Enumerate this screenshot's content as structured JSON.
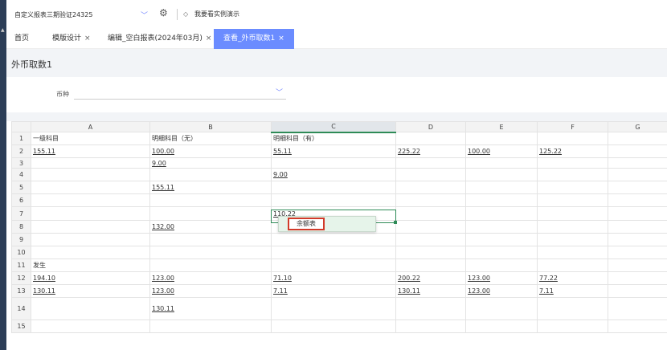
{
  "topbar": {
    "report_name": "自定义报表三期验证24325",
    "demo_label": "我要看实例演示"
  },
  "tabs": [
    {
      "label": "首页",
      "closable": false
    },
    {
      "label": "模版设计",
      "closable": true
    },
    {
      "label": "编辑_空白报表(2024年03月)",
      "closable": true
    },
    {
      "label": "查看_外币取数1",
      "closable": true,
      "active": true
    }
  ],
  "page": {
    "title": "外币取数1",
    "filter_label": "币种",
    "filter_value": ""
  },
  "sheet": {
    "columns": [
      "A",
      "B",
      "C",
      "D",
      "E",
      "F",
      "G"
    ],
    "selected_column": "C",
    "rows": [
      {
        "n": "1",
        "cells": [
          "一级科目",
          "明细科目（无）",
          "明细科目（有）",
          "",
          "",
          "",
          ""
        ]
      },
      {
        "n": "2",
        "cells": [
          "155.11",
          "100.00",
          "55.11",
          "225.22",
          "100.00",
          "125.22",
          ""
        ]
      },
      {
        "n": "3",
        "cells": [
          "",
          "9.00",
          "",
          "",
          "",
          "",
          ""
        ]
      },
      {
        "n": "4",
        "cells": [
          "",
          "",
          "9.00",
          "",
          "",
          "",
          ""
        ]
      },
      {
        "n": "5",
        "cells": [
          "",
          "155.11",
          "",
          "",
          "",
          "",
          ""
        ]
      },
      {
        "n": "6",
        "cells": [
          "",
          "",
          "",
          "",
          "",
          "",
          ""
        ]
      },
      {
        "n": "7",
        "cells": [
          "",
          "",
          "110.22",
          "",
          "",
          "",
          ""
        ]
      },
      {
        "n": "8",
        "cells": [
          "",
          "132.00",
          "",
          "",
          "",
          "",
          ""
        ]
      },
      {
        "n": "9",
        "cells": [
          "",
          "",
          "",
          "",
          "",
          "",
          ""
        ]
      },
      {
        "n": "10",
        "cells": [
          "",
          "",
          "",
          "",
          "",
          "",
          ""
        ]
      },
      {
        "n": "11",
        "cells": [
          "发生",
          "",
          "",
          "",
          "",
          "",
          ""
        ]
      },
      {
        "n": "12",
        "cells": [
          "194.10",
          "123.00",
          "71.10",
          "200.22",
          "123.00",
          "77.22",
          ""
        ]
      },
      {
        "n": "13",
        "cells": [
          "130.11",
          "123.00",
          "7.11",
          "130.11",
          "123.00",
          "7.11",
          ""
        ]
      },
      {
        "n": "14",
        "cells": [
          "",
          "130.11",
          "",
          "",
          "",
          "",
          ""
        ]
      },
      {
        "n": "15",
        "cells": [
          "",
          "",
          "",
          "",
          "",
          "",
          ""
        ]
      }
    ]
  },
  "popup": {
    "item_label": "余额表"
  },
  "colors": {
    "accent": "#6b8cff",
    "selection": "#2e8b57",
    "popup_bg": "#e6f4ea",
    "highlight_border": "#d23a2a"
  }
}
